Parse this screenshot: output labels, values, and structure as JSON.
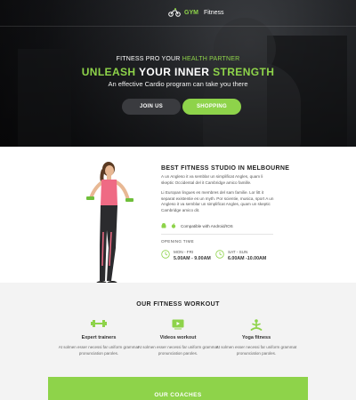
{
  "colors": {
    "accent": "#8ed34a",
    "dark": "#141518"
  },
  "brand": {
    "name": "GYM",
    "suffix": "Fitness",
    "icon": "cyclist-logo-icon"
  },
  "hero": {
    "kicker_pre": "FITNESS PRO YOUR ",
    "kicker_accent": "HEALTH PARTNER",
    "headline_a": "UNLEASH",
    "headline_b": " YOUR INNER ",
    "headline_c": "STRENGTH",
    "subhead": "An effective Cardio program can take you there",
    "join_label": "JOIN US",
    "shop_label": "SHOPPING"
  },
  "about": {
    "title": "BEST FITNESS STUDIO IN MELBOURNE",
    "paragraph1": "A un Angleso it va semblar un simplificat Angles, quam li skeptic Occidental del it Cambridge amico famille.",
    "paragraph2": "Li Europan lingues es membres del sam familie. Lor litt it separat existentie es un myth. Por scientie, musica, sport A un Angleso it va semblar un simplificat Angles, quam un skeptic Cambridge amico dit.",
    "compat_label": "Compatible with Android/IOS",
    "hours_label": "OPENING TIME",
    "hours": [
      {
        "days": "MON - FRI",
        "time": "5.00AM - 9.00AM"
      },
      {
        "days": "SAT - SUN",
        "time": "6.00AM -10.00AM"
      }
    ]
  },
  "workout": {
    "title": "OUR FITNESS WORKOUT",
    "features": [
      {
        "icon": "dumbbell-icon",
        "title": "Expert trainers",
        "desc": "At solmen esser necessi far uniform grammat pronunciation paroles."
      },
      {
        "icon": "video-player-icon",
        "title": "Videos workout",
        "desc": "At solmen esser necessi far uniform grammat pronunciation paroles."
      },
      {
        "icon": "yoga-icon",
        "title": "Yoga fitness",
        "desc": "At solmen esser necessi far uniform grammat pronunciation paroles."
      }
    ]
  },
  "coaches": {
    "title": "OUR COACHES"
  }
}
